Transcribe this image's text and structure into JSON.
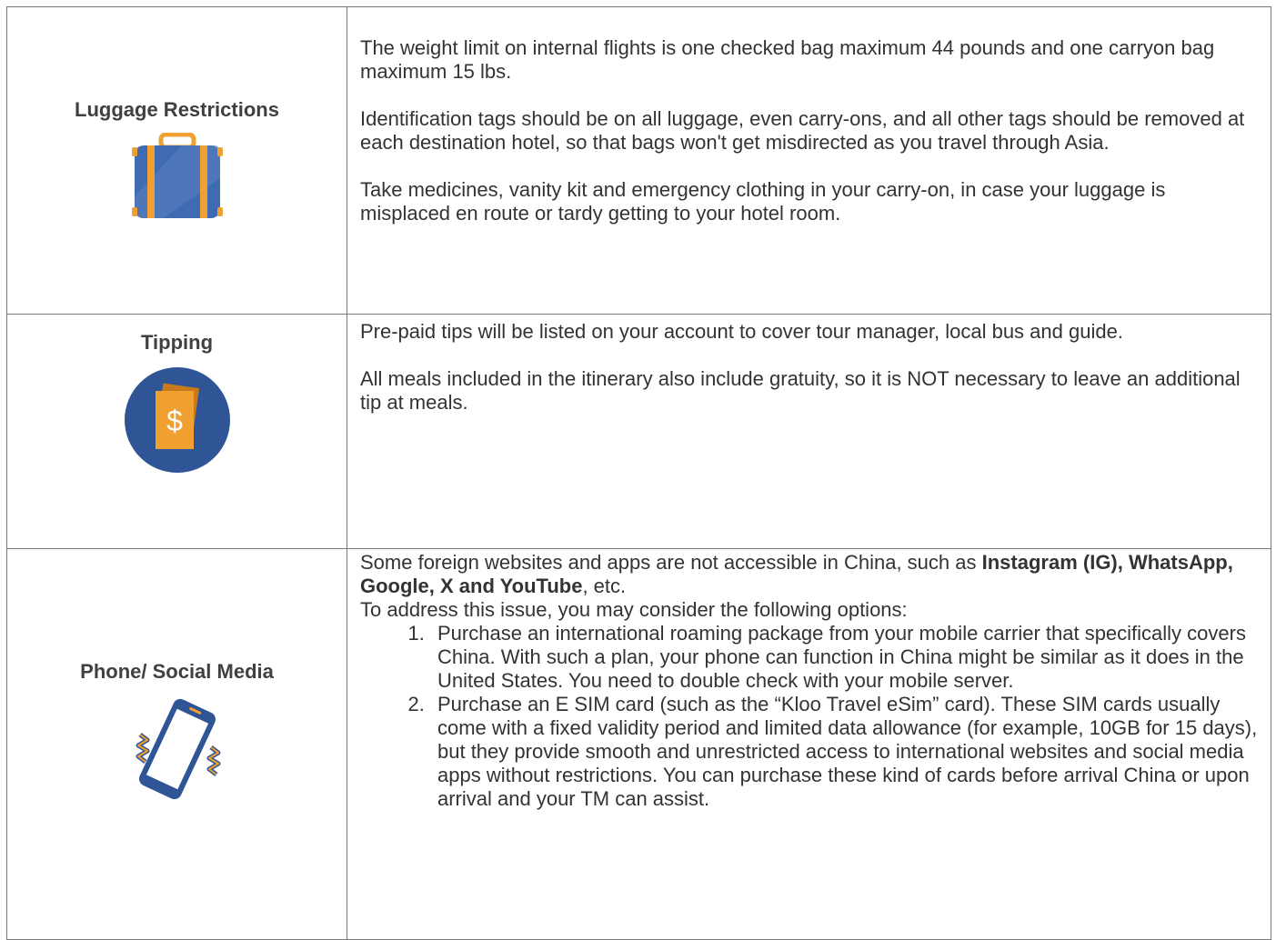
{
  "luggage": {
    "title": "Luggage Restrictions",
    "icon": "suitcase-icon",
    "paragraphs": [
      "The weight limit on internal flights is one checked bag maximum 44 pounds and one carryon bag maximum 15 lbs.",
      "Identification tags should be on all luggage, even carry-ons, and all other tags should be removed at each destination hotel, so that bags won't get misdirected as you travel through Asia.",
      "Take medicines, vanity kit and emergency clothing in your carry-on, in case your luggage is misplaced en route or tardy getting to your hotel room."
    ]
  },
  "tipping": {
    "title": "Tipping",
    "icon": "dollar-bills-icon",
    "paragraphs": [
      "Pre-paid tips will be listed on your account to cover tour manager, local bus and guide.",
      "All meals included in the itinerary also include gratuity, so it is NOT necessary to leave an additional tip at meals."
    ]
  },
  "phone": {
    "title": "Phone/ Social Media",
    "icon": "vibrating-phone-icon",
    "intro_start": "Some foreign websites and apps are not accessible in China, such as ",
    "intro_bold": "Instagram (IG), WhatsApp, Google, X and YouTube",
    "intro_end": ", etc.",
    "options_intro": "To address this issue, you may consider the following options:",
    "options": [
      "Purchase an international roaming package from your mobile carrier that specifically covers China. With such a plan, your phone can function in China might be similar as it does in the United States. You need to double check with your mobile server.",
      "Purchase an E SIM card (such as the “Kloo Travel eSim” card). These SIM cards usually come with a fixed validity period and limited data allowance (for example, 10GB for 15 days), but they provide smooth and unrestricted access to international websites and social media apps without restrictions. You can purchase these kind of cards before arrival China or upon arrival and your TM can assist."
    ]
  },
  "colors": {
    "icon_blue": "#2f5597",
    "icon_orange": "#f0a030",
    "border": "#777777"
  }
}
